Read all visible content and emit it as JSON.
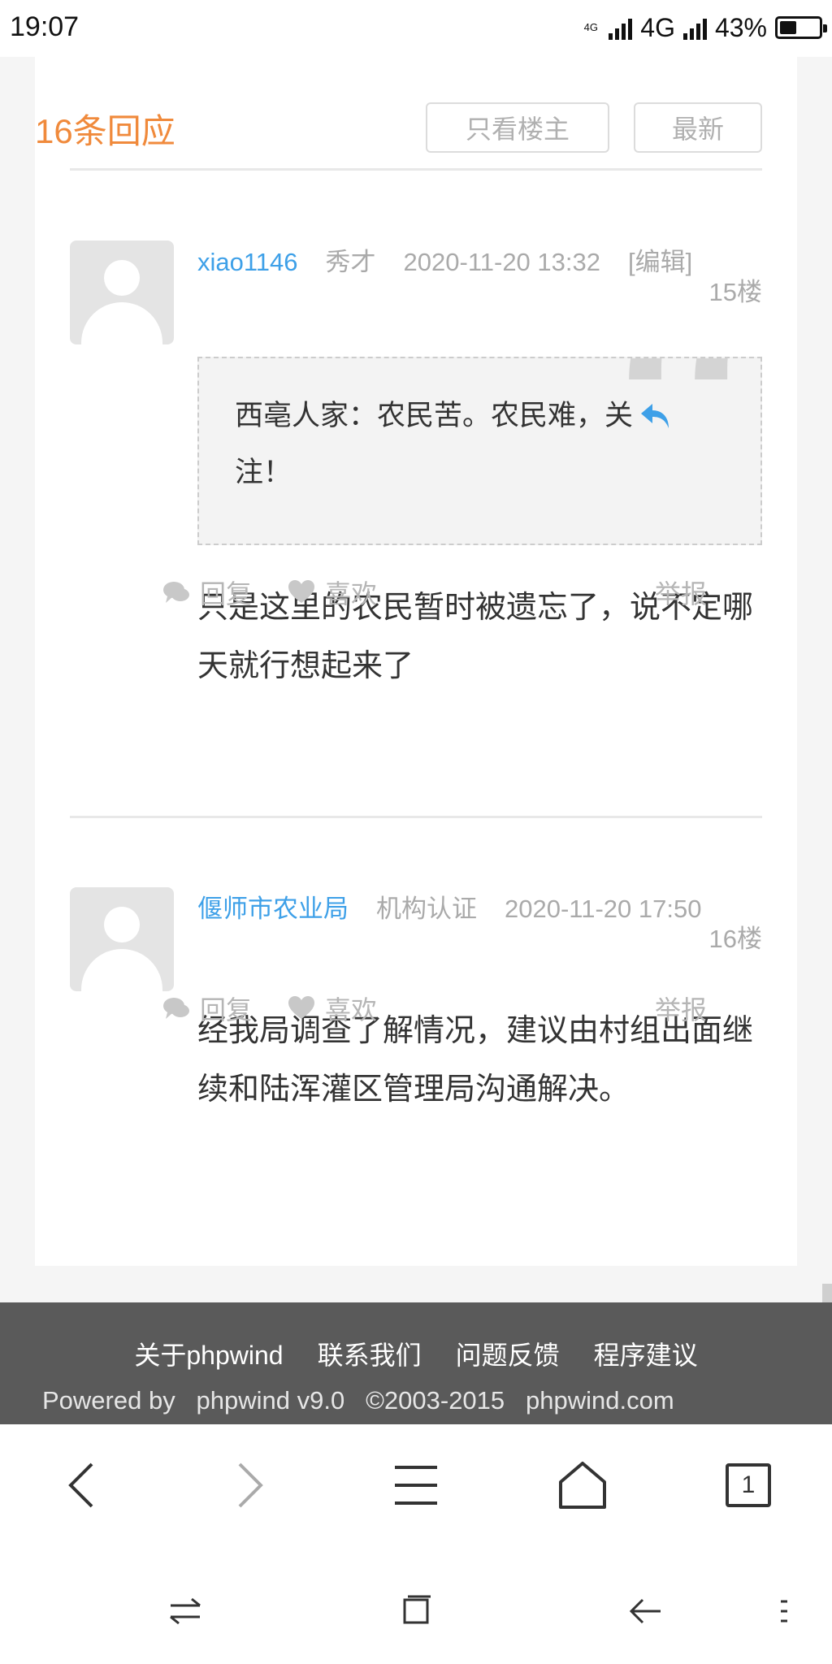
{
  "status_bar": {
    "time": "19:07",
    "net_small": "4G",
    "network_primary": "4G",
    "battery": "43%",
    "battery_level": 0.43
  },
  "thread": {
    "reply_count": "16条回应",
    "btn_owner_only": "只看楼主",
    "btn_latest": "最新"
  },
  "posts": [
    {
      "username": "xiao1146",
      "role": "秀才",
      "time": "2020-11-20 13:32",
      "edit": "[编辑]",
      "floor": "15楼",
      "quote_text": "西亳人家：农民苦。农民难，关注！",
      "content": "只是这里的农民暂时被遗忘了，说不定哪天就行想起来了",
      "reply_label": "回复",
      "like_label": "喜欢",
      "report_label": "举报"
    },
    {
      "username": "偃师市农业局",
      "role": "机构认证",
      "time": "2020-11-20 17:50",
      "floor": "16楼",
      "content": "经我局调查了解情况，建议由村组出面继续和陆浑灌区管理局沟通解决。",
      "reply_label": "回复",
      "like_label": "喜欢",
      "report_label": "举报"
    }
  ],
  "footer": {
    "links": [
      "关于phpwind",
      "联系我们",
      "问题反馈",
      "程序建议"
    ],
    "powered": "Powered by   phpwind v9.0   ©2003-2015   phpwind.com"
  },
  "browser_nav": {
    "tab_count": "1"
  },
  "colors": {
    "accent_orange": "#f08a3c",
    "link_blue": "#3ea0e8",
    "footer_bg": "#5a5a5a"
  },
  "icons": [
    "back-icon",
    "forward-icon",
    "menu-icon",
    "home-icon",
    "tabs-icon",
    "reply-arrow-icon",
    "comment-icon",
    "heart-icon",
    "switch-apps-icon",
    "square-icon",
    "back-arrow-icon",
    "more-icon"
  ]
}
